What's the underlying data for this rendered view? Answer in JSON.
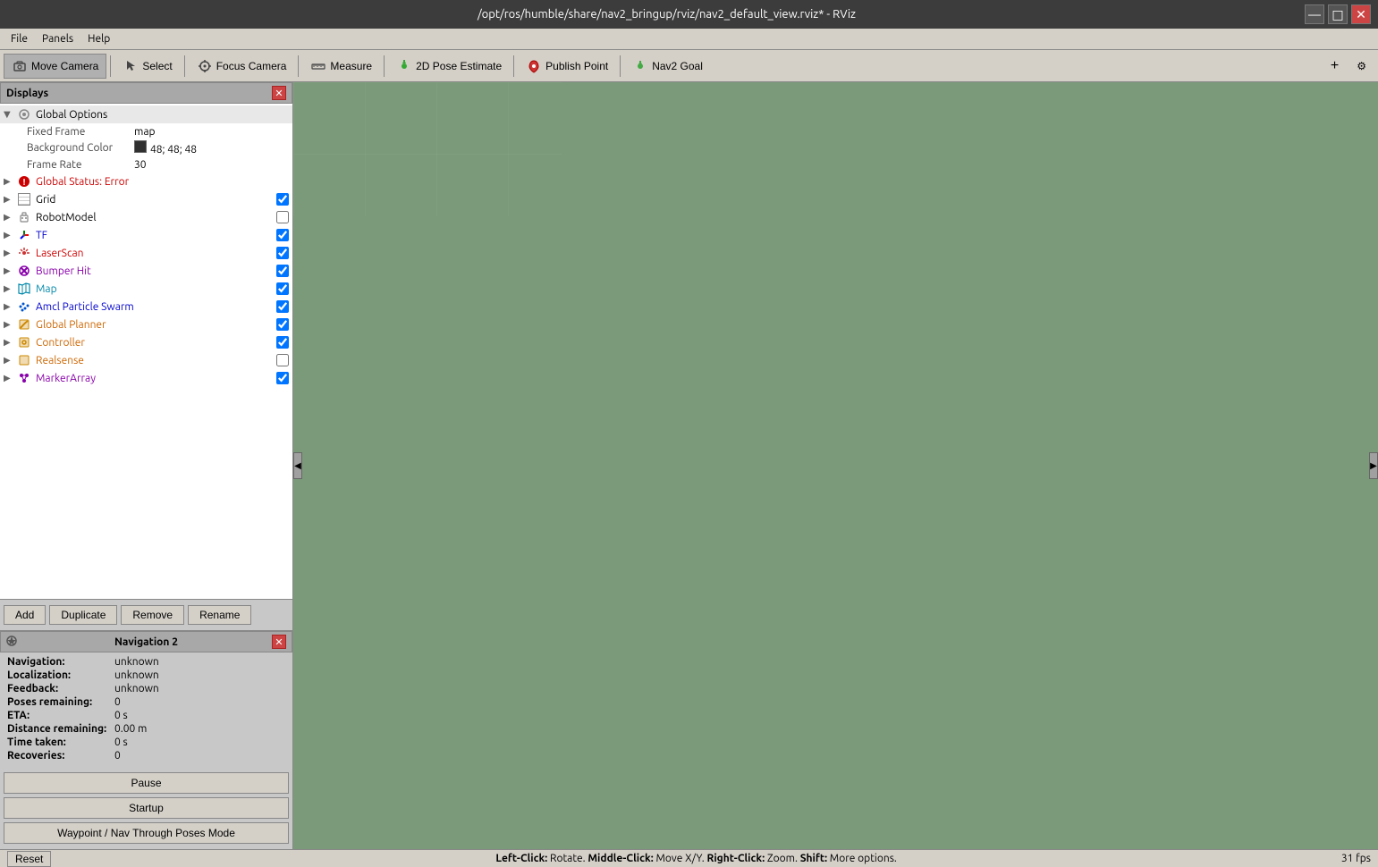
{
  "titlebar": {
    "title": "/opt/ros/humble/share/nav2_bringup/rviz/nav2_default_view.rviz* - RViz",
    "min_btn": "—",
    "max_btn": "□",
    "close_btn": "✕"
  },
  "menubar": {
    "items": [
      {
        "label": "File"
      },
      {
        "label": "Panels"
      },
      {
        "label": "Help"
      }
    ]
  },
  "toolbar": {
    "buttons": [
      {
        "label": "Move Camera",
        "icon": "camera-icon",
        "active": true
      },
      {
        "label": "Select",
        "icon": "cursor-icon",
        "active": false
      },
      {
        "label": "Focus Camera",
        "icon": "focus-icon",
        "active": false
      },
      {
        "label": "Measure",
        "icon": "ruler-icon",
        "active": false
      },
      {
        "label": "2D Pose Estimate",
        "icon": "pose-icon",
        "active": false
      },
      {
        "label": "Publish Point",
        "icon": "point-icon",
        "active": false
      },
      {
        "label": "Nav2 Goal",
        "icon": "nav-goal-icon",
        "active": false
      }
    ],
    "add_btn": "+",
    "settings_btn": "⚙"
  },
  "displays_panel": {
    "title": "Displays",
    "items": [
      {
        "type": "group",
        "expanded": true,
        "icon": "gear-icon",
        "label": "Global Options",
        "subitems": [
          {
            "label": "Fixed Frame",
            "value": "map"
          },
          {
            "label": "Background Color",
            "color": "#303030",
            "value": "48; 48; 48"
          },
          {
            "label": "Frame Rate",
            "value": "30"
          }
        ]
      },
      {
        "type": "item",
        "expanded": false,
        "icon": "error-icon",
        "icon_color": "red",
        "label": "Global Status: Error",
        "checked": null
      },
      {
        "type": "item",
        "expanded": false,
        "icon": "grid-icon",
        "icon_color": "gray",
        "label": "Grid",
        "checked": true
      },
      {
        "type": "item",
        "expanded": false,
        "icon": "robot-icon",
        "icon_color": "gray",
        "label": "RobotModel",
        "checked": false
      },
      {
        "type": "item",
        "expanded": false,
        "icon": "tf-icon",
        "icon_color": "blue",
        "label": "TF",
        "checked": true
      },
      {
        "type": "item",
        "expanded": false,
        "icon": "laser-icon",
        "icon_color": "red",
        "label": "LaserScan",
        "checked": true
      },
      {
        "type": "item",
        "expanded": false,
        "icon": "bumper-icon",
        "icon_color": "purple",
        "label": "Bumper Hit",
        "checked": true
      },
      {
        "type": "item",
        "expanded": false,
        "icon": "map-icon",
        "icon_color": "cyan",
        "label": "Map",
        "checked": true
      },
      {
        "type": "item",
        "expanded": false,
        "icon": "particles-icon",
        "icon_color": "blue",
        "label": "Amcl Particle Swarm",
        "checked": true
      },
      {
        "type": "item",
        "expanded": false,
        "icon": "planner-icon",
        "icon_color": "orange",
        "label": "Global Planner",
        "checked": true
      },
      {
        "type": "item",
        "expanded": false,
        "icon": "controller-icon",
        "icon_color": "orange",
        "label": "Controller",
        "checked": true
      },
      {
        "type": "item",
        "expanded": false,
        "icon": "realsense-icon",
        "icon_color": "orange",
        "label": "Realsense",
        "checked": false
      },
      {
        "type": "item",
        "expanded": false,
        "icon": "marker-icon",
        "icon_color": "purple",
        "label": "MarkerArray",
        "checked": true
      }
    ],
    "buttons": {
      "add": "Add",
      "duplicate": "Duplicate",
      "remove": "Remove",
      "rename": "Rename"
    }
  },
  "nav_panel": {
    "title": "Navigation 2",
    "rows": [
      {
        "label": "Navigation:",
        "value": "unknown"
      },
      {
        "label": "Localization:",
        "value": "unknown"
      },
      {
        "label": "Feedback:",
        "value": "unknown"
      },
      {
        "label": "Poses remaining:",
        "value": "0"
      },
      {
        "label": "ETA:",
        "value": "0 s"
      },
      {
        "label": "Distance remaining:",
        "value": "0.00 m"
      },
      {
        "label": "Time taken:",
        "value": "0 s"
      },
      {
        "label": "Recoveries:",
        "value": "0"
      }
    ],
    "buttons": {
      "pause": "Pause",
      "startup": "Startup",
      "waypoint": "Waypoint / Nav Through Poses Mode"
    }
  },
  "statusbar": {
    "left_text": "Left-Click: Rotate.  Middle-Click: Move X/Y.  Right-Click: Zoom.  Shift: More options.",
    "fps": "31 fps",
    "reset_btn": "Reset"
  }
}
